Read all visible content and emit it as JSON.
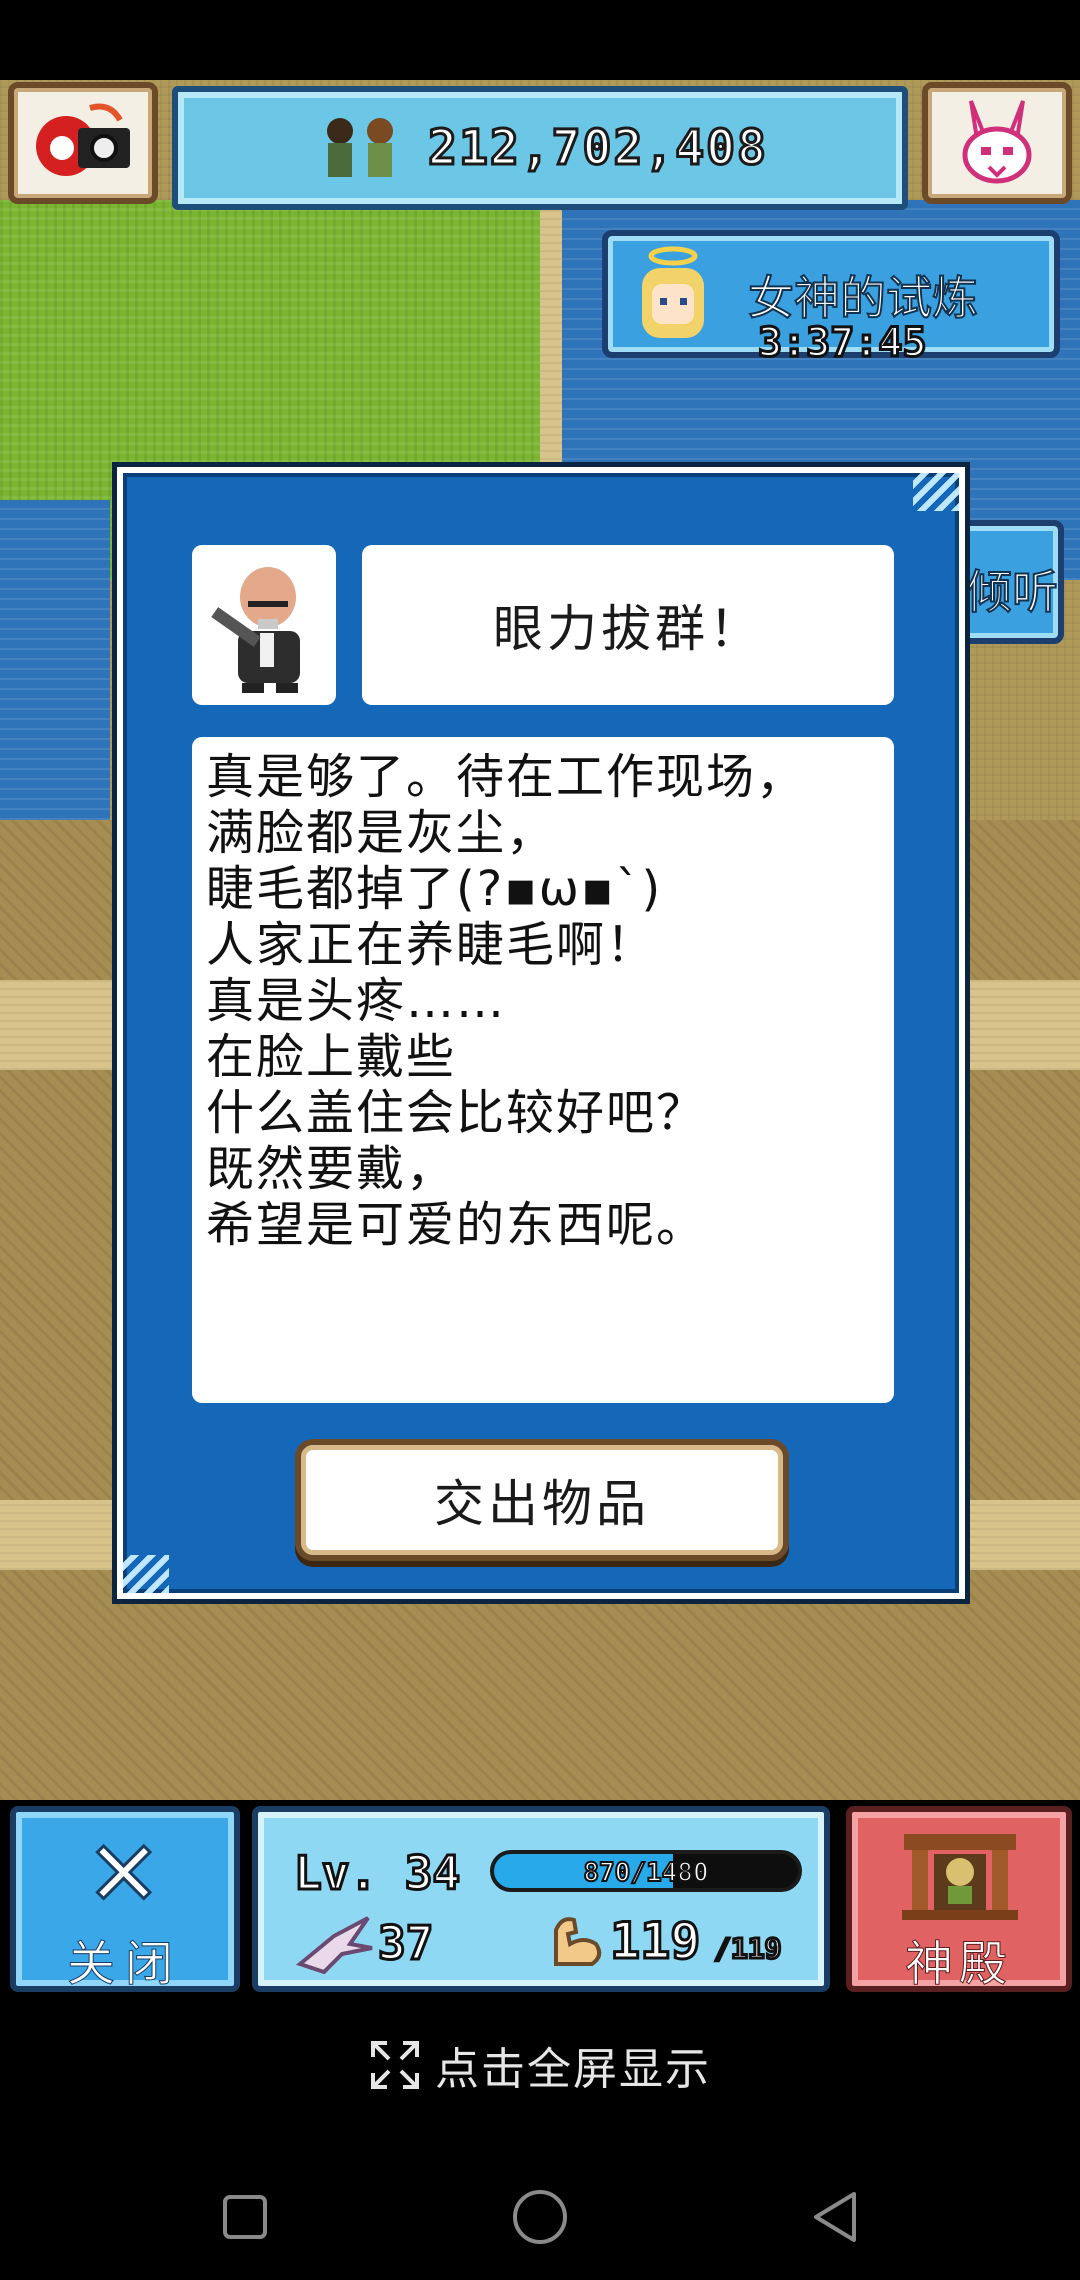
{
  "hud": {
    "population": "212,702,408",
    "event_title": "女神的试炼",
    "event_timer": "3:37:45",
    "side_tab_label": "倾听"
  },
  "dialog": {
    "title": "眼力拔群！",
    "message_lines": [
      "真是够了。待在工作现场，",
      "满脸都是灰尘，",
      "睫毛都掉了(?▪ω▪`)",
      "人家正在养睫毛啊！",
      "真是头疼……",
      "在脸上戴些",
      "什么盖住会比较好吧？",
      "既然要戴，",
      "希望是可爱的东西呢。"
    ],
    "hand_over_button": "交出物品"
  },
  "status": {
    "level": "Lv. 34",
    "xp_text": "870/1480",
    "xp_fraction": 0.588,
    "speed": "37",
    "stamina": "119",
    "stamina_max": "/119"
  },
  "buttons": {
    "close_label": "关闭",
    "temple_label": "神殿"
  },
  "system": {
    "fullscreen_hint": "点击全屏显示"
  },
  "icons": {
    "camera": "camera-icon",
    "rabbit": "rabbit-mask-icon",
    "goddess": "goddess-avatar-icon",
    "villagers": "villagers-icon",
    "npc": "bald-man-portrait-icon",
    "close": "close-icon",
    "temple": "temple-icon",
    "speed": "flying-creature-icon",
    "stamina": "muscle-arm-icon",
    "fullscreen": "expand-icon"
  },
  "colors": {
    "dialog_blue": "#1568b8",
    "hud_sky": "#6cc6e6",
    "close_blue": "#3aa7e8",
    "temple_red": "#e06262",
    "xp_fill": "#27a9ea"
  }
}
